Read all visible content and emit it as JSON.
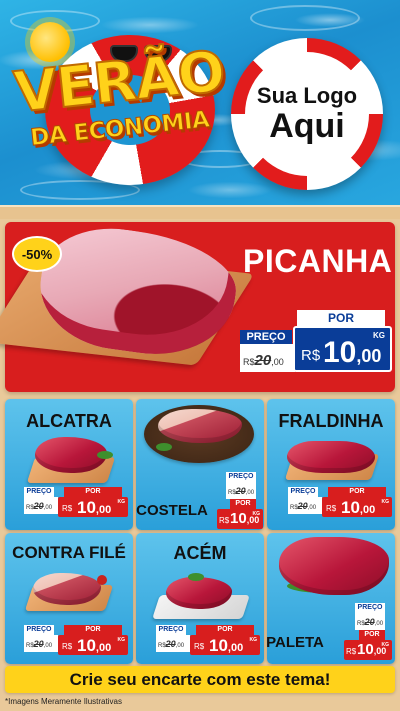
{
  "header": {
    "title_line1": "VERÃO",
    "title_line2": "DA ECONOMIA",
    "logo_line1": "Sua Logo",
    "logo_line2": "Aqui"
  },
  "featured": {
    "name": "PICANHA",
    "discount_badge": "-50%",
    "label_preco": "PREÇO",
    "label_por": "POR",
    "currency": "R$",
    "old_price_int": "20",
    "old_price_dec": ",00",
    "new_price_int": "10",
    "new_price_dec": ",00",
    "unit": "KG"
  },
  "products": [
    {
      "name": "ALCATRA",
      "label_preco": "PREÇO",
      "label_por": "POR",
      "currency": "R$",
      "old_price_int": "20",
      "old_price_dec": ",00",
      "new_price_int": "10",
      "new_price_dec": ",00",
      "unit": "KG"
    },
    {
      "name": "COSTELA",
      "label_preco": "PREÇO",
      "label_por": "POR",
      "currency": "R$",
      "old_price_int": "20",
      "old_price_dec": ",00",
      "new_price_int": "10",
      "new_price_dec": ",00",
      "unit": "KG"
    },
    {
      "name": "FRALDINHA",
      "label_preco": "PREÇO",
      "label_por": "POR",
      "currency": "R$",
      "old_price_int": "20",
      "old_price_dec": ",00",
      "new_price_int": "10",
      "new_price_dec": ",00",
      "unit": "KG"
    },
    {
      "name": "CONTRA FILÉ",
      "label_preco": "PREÇO",
      "label_por": "POR",
      "currency": "R$",
      "old_price_int": "20",
      "old_price_dec": ",00",
      "new_price_int": "10",
      "new_price_dec": ",00",
      "unit": "KG"
    },
    {
      "name": "ACÉM",
      "label_preco": "PREÇO",
      "label_por": "POR",
      "currency": "R$",
      "old_price_int": "20",
      "old_price_dec": ",00",
      "new_price_int": "10",
      "new_price_dec": ",00",
      "unit": "KG"
    },
    {
      "name": "PALETA",
      "label_preco": "PREÇO",
      "label_por": "POR",
      "currency": "R$",
      "old_price_int": "20",
      "old_price_dec": ",00",
      "new_price_int": "10",
      "new_price_dec": ",00",
      "unit": "KG"
    }
  ],
  "footer": {
    "cta": "Crie seu encarte com este tema!",
    "disclaimer": "*Imagens Meramente Ilustrativas"
  },
  "colors": {
    "pool_blue": "#1c8fcf",
    "promo_red": "#d81e1e",
    "price_blue": "#0a3d98",
    "highlight_yellow": "#ffd21a",
    "card_blue": "#2a9fd9"
  },
  "icons": [
    "sun-icon",
    "sunglasses-icon",
    "lifebuoy-icon"
  ]
}
